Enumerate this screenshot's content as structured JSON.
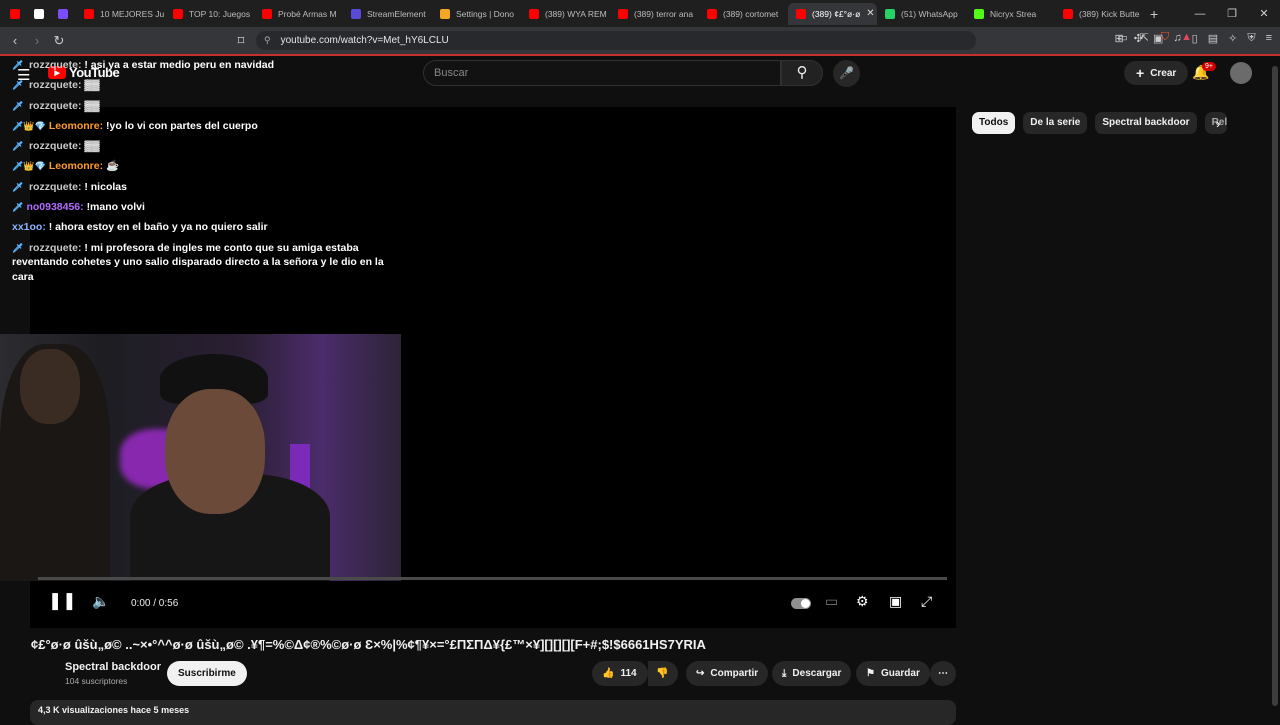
{
  "browser": {
    "tabs": [
      {
        "title": "",
        "color": "#ff0000"
      },
      {
        "title": "",
        "color": "#ffffff"
      },
      {
        "title": "",
        "color": "#7c4dff"
      },
      {
        "title": "10 MEJORES Ju",
        "color": "#ff0000"
      },
      {
        "title": "TOP 10: Juegos",
        "color": "#ff0000"
      },
      {
        "title": "Probé Armas M",
        "color": "#ff0000"
      },
      {
        "title": "StreamElement",
        "color": "#5a4bd6"
      },
      {
        "title": "Settings | Dono",
        "color": "#f5a623"
      },
      {
        "title": "(389) WYA REM",
        "color": "#ff0000"
      },
      {
        "title": "(389) terror ana",
        "color": "#ff0000"
      },
      {
        "title": "(389) cortomet",
        "color": "#ff0000"
      },
      {
        "title": "(389) ¢£°ø·ø",
        "color": "#ff0000"
      },
      {
        "title": "(51) WhatsApp",
        "color": "#25d366"
      },
      {
        "title": "Nicryx Strea",
        "color": "#53fc18"
      },
      {
        "title": "(389) Kick Butte",
        "color": "#ff0000"
      }
    ],
    "active_tab_index": 11,
    "url": "youtube.com/watch?v=Met_hY6LCLU"
  },
  "header": {
    "logo_text": "YouTube",
    "search_placeholder": "Buscar",
    "create_label": "Crear",
    "notifications_badge": "9+"
  },
  "chat": [
    {
      "user": "rozzquete:",
      "user_color": "#c9c9c9",
      "icons": "🗡 ",
      "msg": "! asi ya a estar medio peru en navidad"
    },
    {
      "user": "rozzquete:",
      "user_color": "#c9c9c9",
      "icons": "🗡 ",
      "msg": "▓▓"
    },
    {
      "user": "rozzquete:",
      "user_color": "#c9c9c9",
      "icons": "🗡 ",
      "msg": "▓▓"
    },
    {
      "user": "Leomonre:",
      "user_color": "#ff9b2b",
      "icons": "🗡👑💎",
      "msg": "!yo lo vi con partes del cuerpo"
    },
    {
      "user": "rozzquete:",
      "user_color": "#c9c9c9",
      "icons": "🗡 ",
      "msg": "▓▓"
    },
    {
      "user": "Leomonre:",
      "user_color": "#ff9b2b",
      "icons": "🗡👑💎",
      "msg": "☕"
    },
    {
      "user": "rozzquete:",
      "user_color": "#c9c9c9",
      "icons": "🗡 ",
      "msg": "! nicolas"
    },
    {
      "user": "no0938456:",
      "user_color": "#b36bff",
      "icons": "🗡",
      "msg": "!mano volvi"
    },
    {
      "user": "xx1oo:",
      "user_color": "#8ab4ff",
      "icons": "",
      "msg": "! ahora estoy en el baño y ya no quiero salir"
    },
    {
      "user": "rozzquete:",
      "user_color": "#c9c9c9",
      "icons": "🗡 ",
      "msg": "! mi profesora de ingles me conto que su amiga estaba reventando cohetes y uno salio disparado directo a la señora y le dio en la cara"
    }
  ],
  "player": {
    "time": "0:00 / 0:56",
    "progress": 0
  },
  "chips": [
    "Todos",
    "De la serie",
    "Spectral backdoor",
    "Rel"
  ],
  "video": {
    "title": "¢£°ø·ø ûšù„ø©  ..~×•°^^ø·ø ûšù„ø© .¥¶=%©Δ¢®%©ø·ø Ɛ×%|%¢¶¥×=°£ΠΣΠΔ¥{£™×¥][][][][F+#;$!$6661HS7YRIA",
    "channel": "Spectral backdoor",
    "subscribers": "104 suscriptores",
    "subscribe_label": "Suscribirme",
    "likes": "114",
    "share_label": "Compartir",
    "download_label": "Descargar",
    "save_label": "Guardar",
    "views_line": "4,3 K visualizaciones  hace 5 meses"
  }
}
